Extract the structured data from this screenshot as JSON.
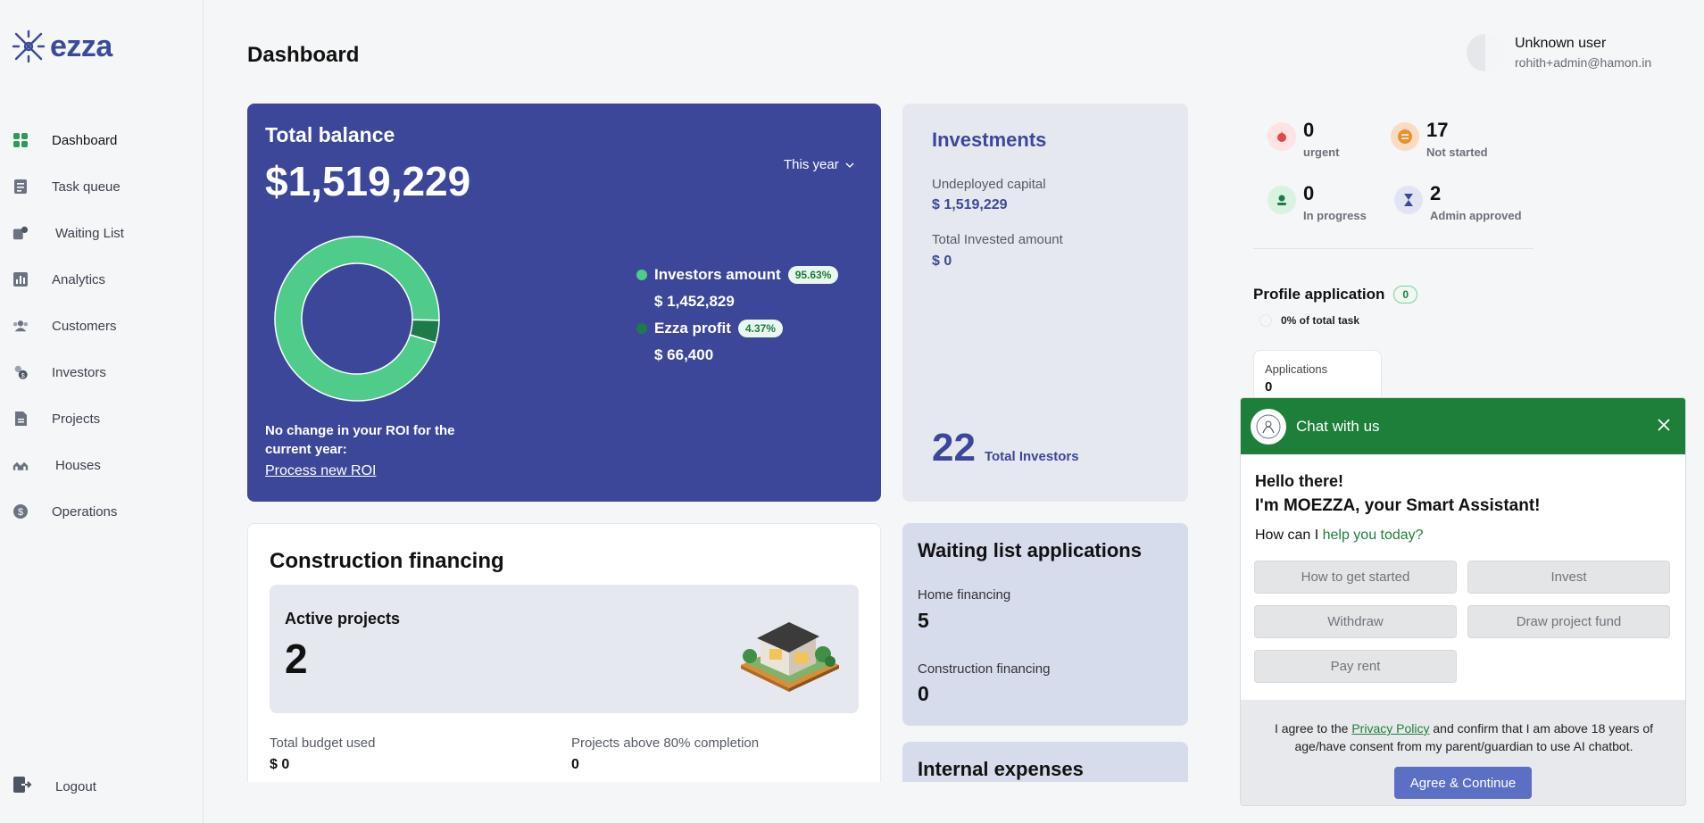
{
  "brand": {
    "name": "ezza",
    "color": "#3c4a9b"
  },
  "sidebar": {
    "items": [
      {
        "label": "Dashboard",
        "icon": "grid-icon",
        "active": true
      },
      {
        "label": "Task queue",
        "icon": "task-icon"
      },
      {
        "label": "Waiting List",
        "icon": "waiting-list-icon"
      },
      {
        "label": "Analytics",
        "icon": "analytics-icon"
      },
      {
        "label": "Customers",
        "icon": "customers-icon"
      },
      {
        "label": "Investors",
        "icon": "investors-icon"
      },
      {
        "label": "Projects",
        "icon": "projects-icon"
      },
      {
        "label": "Houses",
        "icon": "houses-icon"
      },
      {
        "label": "Operations",
        "icon": "operations-icon"
      }
    ],
    "logout": "Logout"
  },
  "header": {
    "title": "Dashboard",
    "user_name": "Unknown user",
    "user_email": "rohith+admin@hamon.in"
  },
  "balance": {
    "title": "Total balance",
    "amount": "$1,519,229",
    "period": "This year",
    "investors_label": "Investors amount",
    "investors_pct": "95.63%",
    "investors_value": "$ 1,452,829",
    "profit_label": "Ezza profit",
    "profit_pct": "4.37%",
    "profit_value": "$ 66,400",
    "roi_text": "No change in your ROI for the current year:",
    "roi_link": "Process new ROI",
    "donut": [
      {
        "name": "Investors amount",
        "value": 95.63,
        "color": "#4fcb8a"
      },
      {
        "name": "Ezza profit",
        "value": 4.37,
        "color": "#1f7a4a"
      }
    ]
  },
  "investments": {
    "title": "Investments",
    "undeployed_label": "Undeployed capital",
    "undeployed_value": "$ 1,519,229",
    "invested_label": "Total Invested amount",
    "invested_value": "$ 0",
    "investors_count": "22",
    "investors_label": "Total Investors"
  },
  "construction": {
    "title": "Construction financing",
    "active_label": "Active projects",
    "active_value": "2",
    "budget_label": "Total budget used",
    "budget_value": "$ 0",
    "above80_label": "Projects above 80% completion",
    "above80_value": "0"
  },
  "waiting": {
    "title": "Waiting list applications",
    "home_label": "Home financing",
    "home_value": "5",
    "construction_label": "Construction financing",
    "construction_value": "0"
  },
  "expenses": {
    "title": "Internal expenses"
  },
  "stats": {
    "urgent": {
      "count": "0",
      "label": "urgent"
    },
    "not_started": {
      "count": "17",
      "label": "Not started"
    },
    "in_progress": {
      "count": "0",
      "label": "In progress"
    },
    "admin_approved": {
      "count": "2",
      "label": "Admin approved"
    }
  },
  "profile_app": {
    "title": "Profile application",
    "badge": "0",
    "progress_text": "0% of total task",
    "apps_label": "Applications",
    "apps_value": "0"
  },
  "chat": {
    "title": "Chat with us",
    "greeting": "Hello there!",
    "intro": "I'm MOEZZA, your Smart Assistant!",
    "question_prefix": "How can I ",
    "question_highlight": "help you today?",
    "chips": [
      "How to get started",
      "Invest",
      "Withdraw",
      "Draw project fund",
      "Pay rent"
    ],
    "consent_prefix": "I agree to the ",
    "consent_link": "Privacy Policy",
    "consent_suffix": " and confirm that I am above 18 years of age/have consent from my parent/guardian to use AI chatbot.",
    "agree_button": "Agree & Continue"
  }
}
